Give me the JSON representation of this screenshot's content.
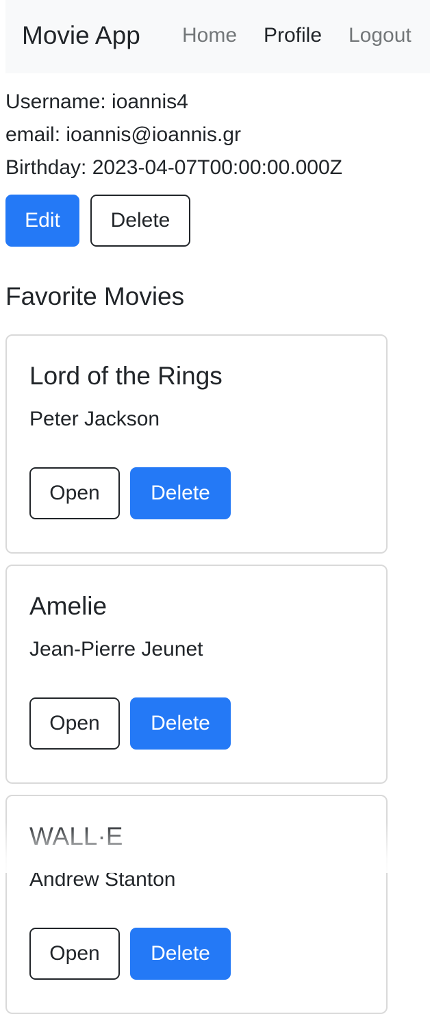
{
  "navbar": {
    "brand": "Movie App",
    "links": [
      "Home",
      "Profile",
      "Logout"
    ],
    "active": "Profile"
  },
  "user": {
    "username_line": "Username: ioannis4",
    "email_line": "email: ioannis@ioannis.gr",
    "birthday_line": "Birthday: 2023-04-07T00:00:00.000Z",
    "edit_label": "Edit",
    "delete_label": "Delete"
  },
  "favorites": {
    "title": "Favorite Movies",
    "movies": [
      {
        "title": "Lord of the Rings",
        "director": "Peter Jackson",
        "open_label": "Open",
        "delete_label": "Delete"
      },
      {
        "title": "Amelie",
        "director": "Jean-Pierre Jeunet",
        "open_label": "Open",
        "delete_label": "Delete"
      },
      {
        "title": "WALL·E",
        "director": "Andrew Stanton",
        "open_label": "Open",
        "delete_label": "Delete"
      }
    ]
  },
  "colors": {
    "primary": "#2479f6",
    "navbar_bg": "#f8f9fa",
    "text": "#212529",
    "card_border": "#d9d9d9"
  }
}
